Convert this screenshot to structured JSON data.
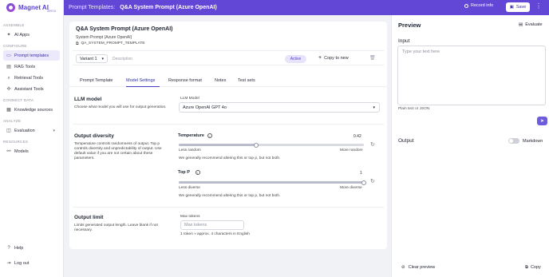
{
  "brand": {
    "name": "Magnet AI",
    "sub": "demo"
  },
  "sidebar": {
    "sections": [
      {
        "label": "ASSEMBLE",
        "items": [
          {
            "label": "AI Apps",
            "icon": "ai-apps-icon"
          }
        ]
      },
      {
        "label": "CONFIGURE",
        "items": [
          {
            "label": "Prompt templates",
            "icon": "prompt-icon",
            "active": true
          },
          {
            "label": "RAG Tools",
            "icon": "rag-icon"
          },
          {
            "label": "Retrieval Tools",
            "icon": "retrieval-icon"
          },
          {
            "label": "Assistant Tools",
            "icon": "assistant-icon"
          }
        ]
      },
      {
        "label": "CONNECT DATA",
        "items": [
          {
            "label": "Knowledge sources",
            "icon": "knowledge-icon"
          }
        ]
      },
      {
        "label": "ANALYZE",
        "items": [
          {
            "label": "Evaluation",
            "icon": "evaluation-icon"
          }
        ]
      },
      {
        "label": "RESOURCES",
        "items": [
          {
            "label": "Models",
            "icon": "models-icon"
          }
        ]
      }
    ],
    "bottom": [
      {
        "label": "Help",
        "icon": "help-icon"
      },
      {
        "label": "Log out",
        "icon": "logout-icon"
      }
    ]
  },
  "topbar": {
    "section": "Prompt Templates:",
    "name": "Q&A System Prompt (Azure OpenAI)",
    "record_label": "Record info",
    "save_label": "Save"
  },
  "header": {
    "title": "Q&A System Prompt (Azure OpenAI)",
    "subtitle": "System Prompt (Azure OpenAI)",
    "constant": "QA_SYSTEM_PROMPT_TEMPLATE"
  },
  "variant": {
    "selected": "Variant 1",
    "description_placeholder": "Description",
    "status": "Active",
    "copy_label": "Copy to new"
  },
  "tabs": [
    "Prompt Template",
    "Model Settings",
    "Response format",
    "Notes",
    "Test sets"
  ],
  "active_tab": "Model Settings",
  "llm": {
    "title": "LLM model",
    "desc": "Choose what model you will use for output generation.",
    "field_label": "LLM Model",
    "value": "Azure OpenAI GPT 4o"
  },
  "diversity": {
    "title": "Output diversity",
    "desc": "Temperature controls randomness of output. Top p controls diversity and unpredictability of output. Use default value if you are not certain about these parameters.",
    "temperature": {
      "label": "Temperature",
      "value": "0.42",
      "fraction": 0.42,
      "min_label": "Less random",
      "max_label": "More random",
      "note": "We generally recommend altering this or top p, but not both."
    },
    "top_p": {
      "label": "Top P",
      "value": "1",
      "fraction": 1.0,
      "min_label": "Less diverse",
      "max_label": "More diverse",
      "note": "We generally recommend altering this or top p, but not both."
    }
  },
  "limit": {
    "title": "Output limit",
    "desc": "Limits generated output length. Leave blank if not necessary.",
    "field_label": "Max tokens",
    "placeholder": "Max tokens",
    "hint": "1 token ≈ approx. 4 characters in English"
  },
  "preview": {
    "title": "Preview",
    "evaluate_label": "Evaluate",
    "input_label": "Input",
    "input_placeholder": "Type your text here",
    "hint": "Plain text or JSON",
    "output_label": "Output",
    "markdown_label": "Markdown",
    "clear_label": "Clear preview",
    "copy_label": "Copy"
  },
  "colors": {
    "accent": "#6247d6",
    "active_bg": "#ece9fb"
  }
}
